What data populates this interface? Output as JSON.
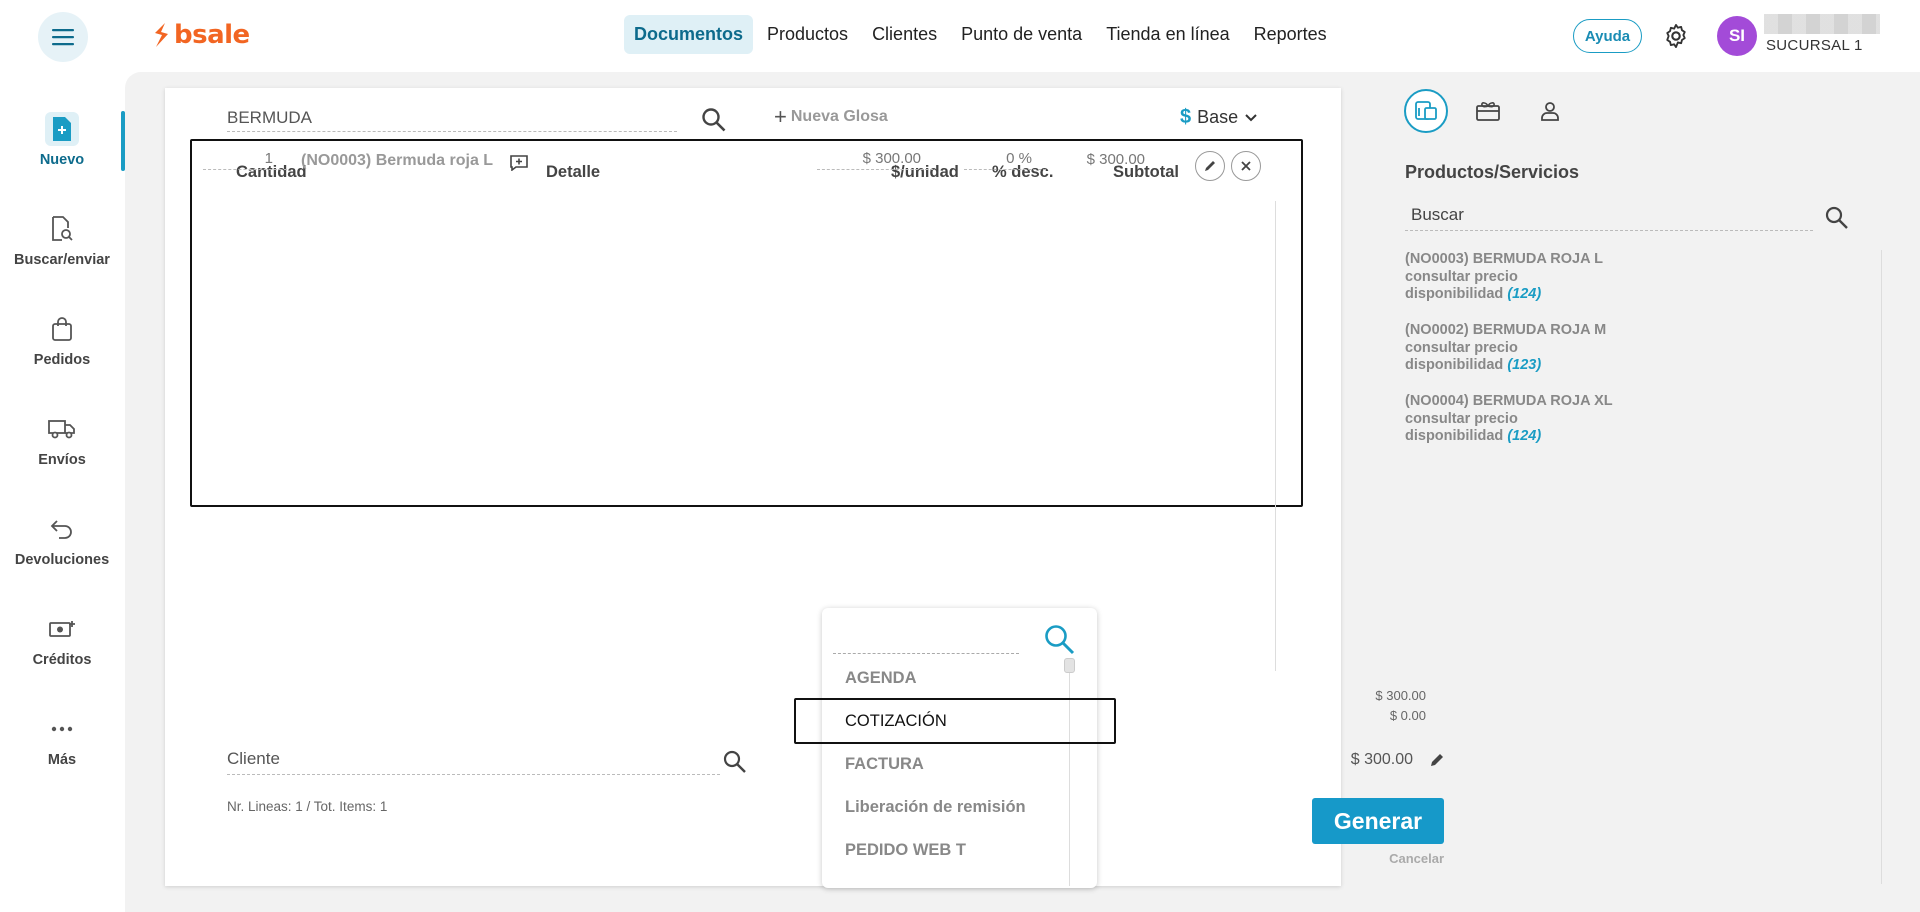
{
  "app": {
    "logo_text": "bsale",
    "brand_color": "#f26522",
    "accent_color": "#1a9cc4"
  },
  "topnav": {
    "items": [
      {
        "label": "Documentos",
        "active": true
      },
      {
        "label": "Productos"
      },
      {
        "label": "Clientes"
      },
      {
        "label": "Punto de venta"
      },
      {
        "label": "Tienda en línea"
      },
      {
        "label": "Reportes"
      }
    ],
    "help_label": "Ayuda",
    "avatar_initials": "SI",
    "branch": "SUCURSAL 1"
  },
  "sidebar": {
    "items": [
      {
        "label": "Nuevo",
        "icon": "new-document-icon",
        "active": true
      },
      {
        "label": "Buscar/enviar",
        "icon": "search-document-icon"
      },
      {
        "label": "Pedidos",
        "icon": "shopping-bag-icon"
      },
      {
        "label": "Envíos",
        "icon": "truck-icon"
      },
      {
        "label": "Devoluciones",
        "icon": "return-arrow-icon"
      },
      {
        "label": "Créditos",
        "icon": "money-icon"
      },
      {
        "label": "Más",
        "icon": "more-dots-icon"
      }
    ]
  },
  "document": {
    "product_search_value": "BERMUDA",
    "new_glosa_label": "Nueva Glosa",
    "price_list_symbol": "$",
    "price_list_label": "Base",
    "columns": {
      "quantity": "Cantidad",
      "detail": "Detalle",
      "unit_price": "$/unidad",
      "discount": "% desc.",
      "subtotal": "Subtotal"
    },
    "lines": [
      {
        "quantity": "1",
        "detail": "(NO0003) Bermuda roja L",
        "unit_price": "$ 300.00",
        "discount": "0 %",
        "subtotal": "$ 300.00"
      }
    ],
    "client_placeholder": "Cliente",
    "lines_info": "Nr. Lineas: 1 / Tot. Items: 1",
    "totals": {
      "net": "$ 300.00",
      "tax": "$ 0.00",
      "total": "$ 300.00"
    },
    "generate_label": "Generar",
    "cancel_label": "Cancelar"
  },
  "doc_type_dropdown": {
    "search_value": "",
    "options": [
      "AGENDA",
      "COTIZACIÓN",
      "FACTURA",
      "Liberación de remisión",
      "PEDIDO WEB T"
    ],
    "selected": "COTIZACIÓN"
  },
  "right_panel": {
    "tabs": [
      "pos-device-icon",
      "gift-card-icon",
      "user-icon"
    ],
    "title": "Productos/Servicios",
    "search_value": "Buscar",
    "products": [
      {
        "name": "(NO0003) BERMUDA ROJA L",
        "price": "consultar precio",
        "availability_label": "disponibilidad",
        "availability": "(124)"
      },
      {
        "name": "(NO0002) BERMUDA ROJA M",
        "price": "consultar precio",
        "availability_label": "disponibilidad",
        "availability": "(123)"
      },
      {
        "name": "(NO0004) BERMUDA ROJA XL",
        "price": "consultar precio",
        "availability_label": "disponibilidad",
        "availability": "(124)"
      }
    ]
  }
}
